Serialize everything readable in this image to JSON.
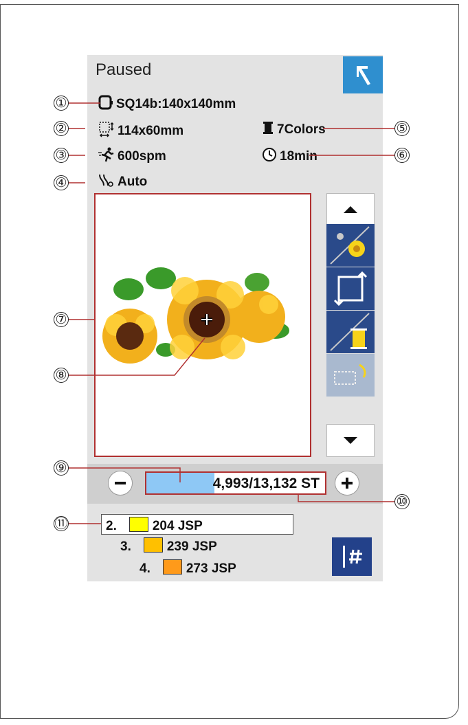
{
  "screen": {
    "title": "Paused",
    "back_button": "back-arrow-icon",
    "hoop": "SQ14b:140x140mm",
    "design_size": "114x60mm",
    "colors": "7Colors",
    "speed": "600spm",
    "time": "18min",
    "thread_cut": "Auto",
    "stitch_counter": {
      "current": "4,993",
      "total": "13,132",
      "unit": "ST",
      "text": "4,993/13,132 ST",
      "progress": 0.38
    },
    "color_list": [
      {
        "index": "2.",
        "label": "204 JSP",
        "color": "#ffff00"
      },
      {
        "index": "3.",
        "label": "239 JSP",
        "color": "#ffc000"
      },
      {
        "index": "4.",
        "label": "273 JSP",
        "color": "#ff9a1a"
      }
    ]
  },
  "callouts": [
    "①",
    "②",
    "③",
    "④",
    "⑤",
    "⑥",
    "⑦",
    "⑧",
    "⑨",
    "⑩",
    "⑪"
  ],
  "accent": {
    "blue": "#2f8fcf",
    "navy": "#23418a",
    "red_leader": "#b03030"
  }
}
